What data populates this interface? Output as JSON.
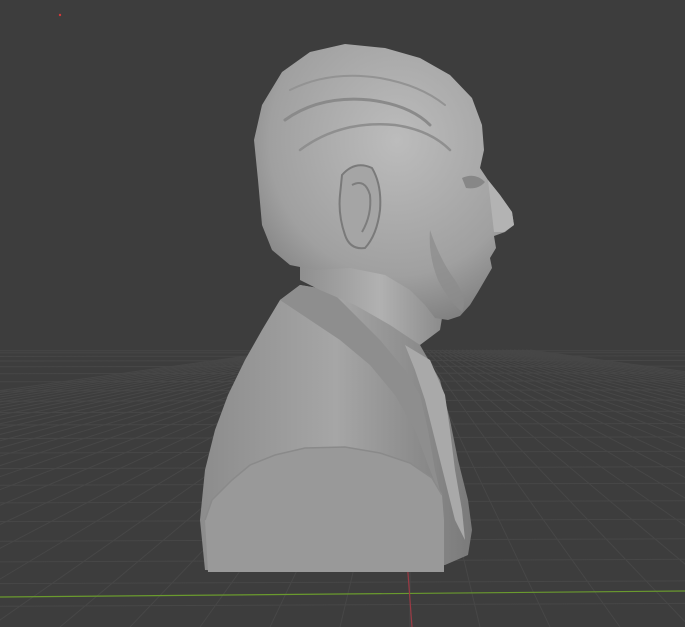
{
  "viewport": {
    "mode": "3d-viewport",
    "shading": "solid",
    "object": "bust-sculpt-mesh",
    "colors": {
      "background": "#3d3d3d",
      "grid": "#4a4a4a",
      "x_axis": "#9b3a44",
      "y_axis": "#6a9a2e",
      "mesh_base": "#9a9a9a",
      "mesh_light": "#b8b8b8",
      "mesh_dark": "#6e6e6e",
      "origin_marker": "#d03a3a"
    }
  }
}
